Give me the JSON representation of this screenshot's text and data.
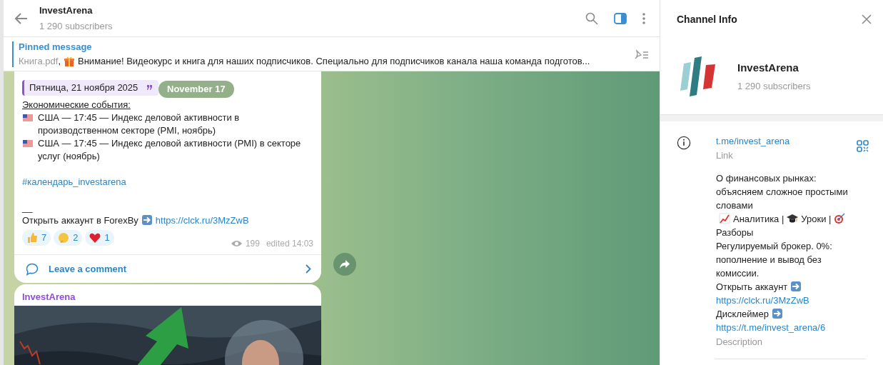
{
  "header": {
    "title": "InvestArena",
    "subtitle": "1 290 subscribers"
  },
  "pinned": {
    "label": "Pinned message",
    "preview": [
      {
        "kind": "file",
        "text": "Книга.pdf"
      },
      {
        "kind": "text",
        "text": ","
      },
      {
        "kind": "gift"
      },
      {
        "kind": "text",
        "text": "Внимание! Видеокурс и книга для наших подписчиков.  Специально для подписчиков канала наша команда подготов..."
      }
    ]
  },
  "date_pill": "November 17",
  "message": {
    "quote": "Пятница, 21 ноября 2025",
    "paragraphs": [
      [
        [
          {
            "kind": "underline",
            "text": "Экономические события:"
          }
        ],
        [
          {
            "kind": "us_flag"
          },
          {
            "kind": "text",
            "text": "США — 17:45 — Индекс деловой активности в производственном секторе (PMI, ноябрь)"
          }
        ],
        [
          {
            "kind": "us_flag"
          },
          {
            "kind": "text",
            "text": "США — 17:45 — Индекс деловой активности (PMI) в секторе услуг (ноябрь)"
          }
        ]
      ],
      [
        [
          {
            "kind": "link",
            "text": "#календарь_investarena"
          }
        ]
      ],
      [
        [
          {
            "kind": "text",
            "text": "__"
          }
        ],
        [
          {
            "kind": "text",
            "text": "Открыть аккаунт в ForexBy"
          },
          {
            "kind": "arrow_right"
          },
          {
            "kind": "link",
            "text": "https://clck.ru/3MzZwB"
          }
        ]
      ]
    ],
    "reactions": [
      {
        "kind": "thumbs_up",
        "count": "7"
      },
      {
        "kind": "thinking",
        "count": "2"
      },
      {
        "kind": "heart",
        "count": "1"
      }
    ],
    "views": "199",
    "edited": "edited 14:03",
    "comment": "Leave a comment"
  },
  "next_post": {
    "author": "InvestArena"
  },
  "info": {
    "title": "Channel Info",
    "name": "InvestArena",
    "subscribers": "1 290 subscribers",
    "link": "t.me/invest_arena",
    "link_label": "Link",
    "description": [
      [
        {
          "kind": "text",
          "text": "О финансовых рынках: объясняем сложное простыми словами"
        }
      ],
      [
        {
          "kind": "chart"
        },
        {
          "kind": "text",
          "text": "Аналитика |"
        },
        {
          "kind": "graduation_cap"
        },
        {
          "kind": "text",
          "text": "Уроки |"
        },
        {
          "kind": "target"
        },
        {
          "kind": "text",
          "text": "Разборы"
        }
      ],
      [
        {
          "kind": "text",
          "text": "Регулируемый брокер. 0%: пополнение и вывод без комиссии."
        }
      ],
      [
        {
          "kind": "text",
          "text": "Открыть аккаунт"
        },
        {
          "kind": "arrow_right"
        }
      ],
      [
        {
          "kind": "link",
          "text": "https://clck.ru/3MzZwB"
        }
      ],
      [
        {
          "kind": "text",
          "text": "Дисклеймер"
        },
        {
          "kind": "arrow_right"
        }
      ],
      [
        {
          "kind": "link",
          "text": "https://t.me/invest_arena/6"
        }
      ]
    ],
    "description_label": "Description"
  }
}
